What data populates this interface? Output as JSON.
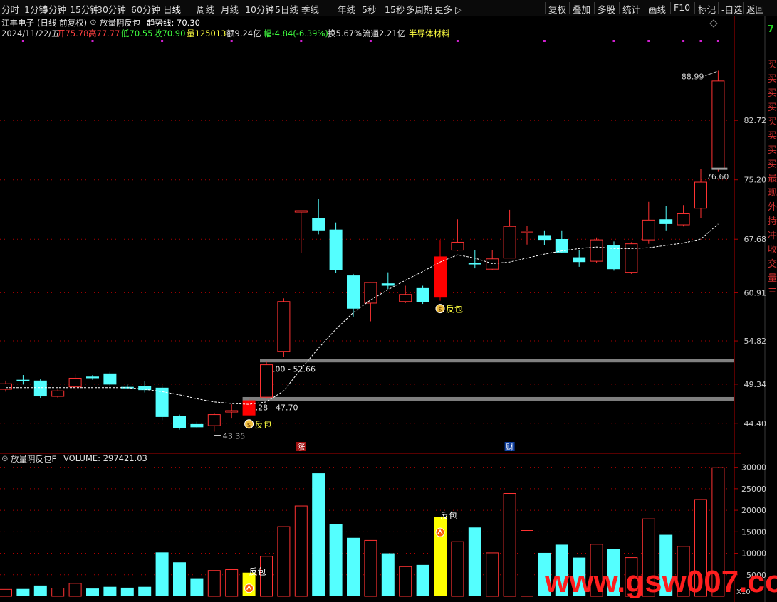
{
  "toolbar": {
    "periods": [
      "分时",
      "1分钟",
      "5分钟",
      "15分钟",
      "30分钟",
      "60分钟",
      "日线",
      "周线",
      "月线",
      "10分钟",
      "45日线",
      "季线",
      "年线",
      "5秒",
      "15秒",
      "多周期",
      "更多"
    ],
    "active_period": "日线",
    "right_buttons": [
      "复权",
      "叠加",
      "多股",
      "统计",
      "画线",
      "F10",
      "标记",
      "-自选",
      "返回"
    ]
  },
  "info": {
    "stock_name": "江丰电子",
    "mode": "(日线 前复权)",
    "indicator_name": "放量阴反包",
    "trend_label": "趋势线: 70.30",
    "date": "2024/11/22/五",
    "open": "开75.78",
    "high": "高77.77",
    "low": "低70.55",
    "close": "收70.90",
    "volume": "量125013",
    "amount": "额9.24亿",
    "change": "幅-4.84(-6.39%)",
    "turnover": "换5.67%",
    "float_value": "流通2.21亿",
    "sector": "半导体材料"
  },
  "volume_panel": {
    "title": "放量阴反包F",
    "volume_label": "VOLUME: 297421.03",
    "multiplier": "X10"
  },
  "right_panel_glyphs": [
    "7",
    "买",
    "买",
    "买",
    "买",
    "买",
    "买",
    "买",
    "买",
    "最",
    "现",
    "外",
    "持",
    "冲",
    "收",
    "交",
    "量",
    "三"
  ],
  "colors": {
    "up": "#ff3232",
    "down": "#54ffff",
    "signal": "#ff0000",
    "signal_vol": "#ffff00",
    "trend": "#ffffff",
    "axis": "#b00000",
    "support": "#808080"
  },
  "chart_data": [
    {
      "type": "candlestick",
      "title": "江丰电子 (日线 前复权)",
      "y_ticks": [
        44.4,
        49.34,
        54.82,
        60.91,
        67.68,
        75.2,
        82.72
      ],
      "ylim": [
        41.5,
        93.0
      ],
      "candles": [
        {
          "open": 48.7,
          "close": 49.4,
          "high": 49.8,
          "low": 48.4
        },
        {
          "open": 49.9,
          "close": 49.7,
          "high": 50.5,
          "low": 49.3
        },
        {
          "open": 49.8,
          "close": 47.8,
          "high": 50.0,
          "low": 47.6
        },
        {
          "open": 47.8,
          "close": 48.5,
          "high": 48.7,
          "low": 47.6
        },
        {
          "open": 49.0,
          "close": 50.1,
          "high": 50.6,
          "low": 48.6
        },
        {
          "open": 50.3,
          "close": 50.1,
          "high": 50.5,
          "low": 49.9
        },
        {
          "open": 50.7,
          "close": 49.3,
          "high": 50.9,
          "low": 49.1
        },
        {
          "open": 49.0,
          "close": 48.9,
          "high": 49.3,
          "low": 48.7
        },
        {
          "open": 49.1,
          "close": 48.6,
          "high": 49.7,
          "low": 48.3
        },
        {
          "open": 48.9,
          "close": 45.2,
          "high": 49.2,
          "low": 44.8
        },
        {
          "open": 45.3,
          "close": 43.8,
          "high": 45.5,
          "low": 43.6
        },
        {
          "open": 44.3,
          "close": 43.9,
          "high": 44.6,
          "low": 43.8
        },
        {
          "open": 44.1,
          "close": 45.5,
          "high": 45.7,
          "low": 43.35
        },
        {
          "open": 46.0,
          "close": 46.0,
          "high": 46.8,
          "low": 45.0
        },
        {
          "open": 45.4,
          "close": 47.3,
          "high": 47.6,
          "low": 45.3
        },
        {
          "open": 47.7,
          "close": 51.8,
          "high": 52.3,
          "low": 47.5
        },
        {
          "open": 53.5,
          "close": 59.8,
          "high": 60.2,
          "low": 52.8
        },
        {
          "open": 71.3,
          "close": 71.3,
          "high": 71.3,
          "low": 65.9
        },
        {
          "open": 70.4,
          "close": 68.8,
          "high": 72.8,
          "low": 68.3
        },
        {
          "open": 68.9,
          "close": 63.8,
          "high": 69.8,
          "low": 63.4
        },
        {
          "open": 63.1,
          "close": 58.9,
          "high": 63.3,
          "low": 57.9
        },
        {
          "open": 59.6,
          "close": 62.2,
          "high": 62.3,
          "low": 57.3
        },
        {
          "open": 62.1,
          "close": 61.8,
          "high": 63.5,
          "low": 61.4
        },
        {
          "open": 59.8,
          "close": 60.7,
          "high": 61.8,
          "low": 59.6
        },
        {
          "open": 61.5,
          "close": 59.7,
          "high": 61.8,
          "low": 59.5
        },
        {
          "open": 60.3,
          "close": 65.5,
          "high": 67.6,
          "low": 59.9
        },
        {
          "open": 66.3,
          "close": 67.3,
          "high": 70.2,
          "low": 66.2
        },
        {
          "open": 64.7,
          "close": 64.5,
          "high": 66.3,
          "low": 64.0
        },
        {
          "open": 63.9,
          "close": 65.2,
          "high": 66.3,
          "low": 63.8
        },
        {
          "open": 65.3,
          "close": 69.3,
          "high": 71.4,
          "low": 65.3
        },
        {
          "open": 68.6,
          "close": 68.7,
          "high": 69.4,
          "low": 67.0
        },
        {
          "open": 68.2,
          "close": 67.6,
          "high": 68.8,
          "low": 66.9
        },
        {
          "open": 67.7,
          "close": 66.0,
          "high": 68.8,
          "low": 65.9
        },
        {
          "open": 65.4,
          "close": 64.8,
          "high": 66.3,
          "low": 64.2
        },
        {
          "open": 64.9,
          "close": 67.6,
          "high": 67.9,
          "low": 64.7
        },
        {
          "open": 66.9,
          "close": 63.9,
          "high": 67.4,
          "low": 63.7
        },
        {
          "open": 63.5,
          "close": 67.1,
          "high": 67.3,
          "low": 63.3
        },
        {
          "open": 67.6,
          "close": 70.1,
          "high": 72.4,
          "low": 67.1
        },
        {
          "open": 70.2,
          "close": 69.6,
          "high": 71.9,
          "low": 68.8
        },
        {
          "open": 69.5,
          "close": 70.9,
          "high": 72.0,
          "low": 69.3
        },
        {
          "open": 71.6,
          "close": 74.9,
          "high": 76.6,
          "low": 70.4
        },
        {
          "open": 76.6,
          "close": 87.7,
          "high": 88.99,
          "low": 76.2
        }
      ],
      "trend_line": [
        48.9,
        48.9,
        48.9,
        48.9,
        48.9,
        48.9,
        48.9,
        48.9,
        48.7,
        48.4,
        48.0,
        47.5,
        47.1,
        46.9,
        46.8,
        47.1,
        48.5,
        51.3,
        53.9,
        56.3,
        58.4,
        60.0,
        61.3,
        62.5,
        63.6,
        64.8,
        65.7,
        65.3,
        64.6,
        64.8,
        65.3,
        65.8,
        66.2,
        66.5,
        66.7,
        66.5,
        66.5,
        66.6,
        66.9,
        67.2,
        67.7,
        69.6
      ],
      "support_lines": [
        {
          "label": "52.00 - 52.66",
          "value": 52.33,
          "from_index": 15
        },
        {
          "label": "47.28 - 47.70",
          "value": 47.49,
          "from_index": 14
        }
      ],
      "signals": [
        {
          "index": 14,
          "label": "反包"
        },
        {
          "index": 25,
          "label": "反包"
        }
      ],
      "annotations": [
        {
          "index": 12,
          "label": "43.35",
          "value": 43.35
        },
        {
          "index": 41,
          "label": "88.99",
          "value": 88.99
        },
        {
          "index": 41,
          "label": "76.60",
          "value": 76.6
        }
      ],
      "markers": [
        {
          "index": 17,
          "label": "涨"
        },
        {
          "index": 29,
          "label": "财"
        }
      ],
      "top_dot_indices": [
        1,
        5,
        9,
        13,
        17,
        21,
        26,
        31,
        35,
        37,
        39,
        40,
        41
      ]
    },
    {
      "type": "bar",
      "title": "放量阴反包F VOLUME: 297421.03",
      "y_ticks": [
        5000,
        10000,
        15000,
        20000,
        25000,
        30000
      ],
      "ylim": [
        0,
        30600
      ],
      "values": [
        1600,
        1700,
        2500,
        1900,
        3000,
        1800,
        2200,
        2000,
        2200,
        10200,
        7900,
        4200,
        6000,
        6200,
        5500,
        9300,
        16200,
        21000,
        28600,
        16800,
        13600,
        13000,
        10000,
        6900,
        7300,
        18500,
        12700,
        16000,
        10100,
        23900,
        15300,
        10100,
        12000,
        9000,
        12100,
        11000,
        9000,
        18000,
        14300,
        11600,
        22500,
        29900
      ],
      "signal_indices": [
        14,
        25
      ],
      "signal_labels": [
        "反包",
        "反包"
      ]
    }
  ]
}
